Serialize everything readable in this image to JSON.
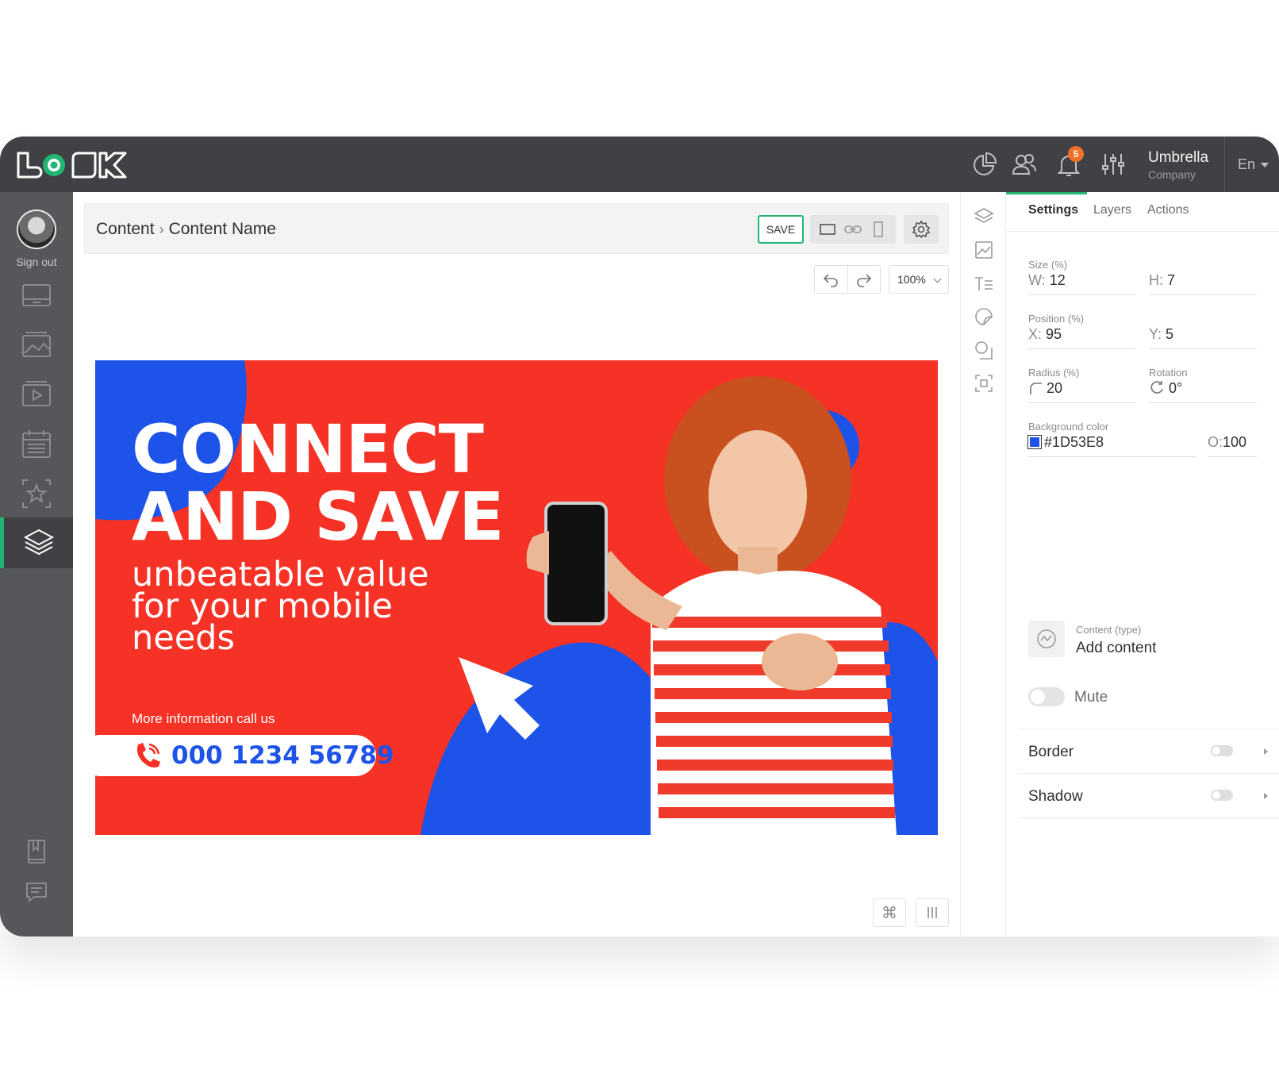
{
  "app": {
    "brand_colors": {
      "topbar": "#404144",
      "sidebar": "#55575b",
      "accent": "#22b573",
      "notif": "#f0702a"
    }
  },
  "topbar": {
    "icons": [
      "chart-pie-icon",
      "users-icon",
      "bell-icon",
      "sliders-icon"
    ],
    "notification_count": "5",
    "company_name": "Umbrella",
    "company_sub": "Company",
    "language": "En"
  },
  "sidebar": {
    "signout_label": "Sign out",
    "items": [
      "display-icon",
      "image-icon",
      "video-icon",
      "calendar-icon",
      "star-frame-icon",
      "layers-icon",
      "book-icon",
      "chat-icon"
    ],
    "active": "layers-icon"
  },
  "editor": {
    "breadcrumb": {
      "root": "Content",
      "current": "Content Name"
    },
    "save_label": "SAVE",
    "zoom": "100%",
    "bottom_icons": [
      "command-icon",
      "columns-icon"
    ]
  },
  "banner": {
    "headline_line1": "CONNECT",
    "headline_line2": "AND SAVE",
    "sub_line1": "unbeatable value",
    "sub_line2": "for your mobile",
    "sub_line3": "needs",
    "more_info": "More information call us",
    "phone": "000 1234 56789",
    "colors": {
      "red": "#f53225",
      "blue": "#1d53e8"
    }
  },
  "toolstrip": {
    "icons": [
      "layers-icon",
      "image-icon",
      "text-icon",
      "sticker-icon",
      "shapes-icon",
      "qr-icon"
    ]
  },
  "panel": {
    "tabs": [
      "Settings",
      "Layers",
      "Actions"
    ],
    "active_tab": "Settings",
    "size": {
      "label": "Size (%)",
      "w_key": "W:",
      "w": "12",
      "h_key": "H:",
      "h": "7"
    },
    "position": {
      "label": "Position (%)",
      "x_key": "X:",
      "x": "95",
      "y_key": "Y:",
      "y": "5"
    },
    "radius": {
      "label": "Radius (%)",
      "value": "20"
    },
    "rotation": {
      "label": "Rotation",
      "value": "0°"
    },
    "background": {
      "label": "Background color",
      "value": "#1D53E8",
      "opacity_key": "O:",
      "opacity": "100"
    },
    "content_type": {
      "label": "Content (type)",
      "value": "Add content"
    },
    "mute_label": "Mute",
    "border_label": "Border",
    "shadow_label": "Shadow"
  }
}
